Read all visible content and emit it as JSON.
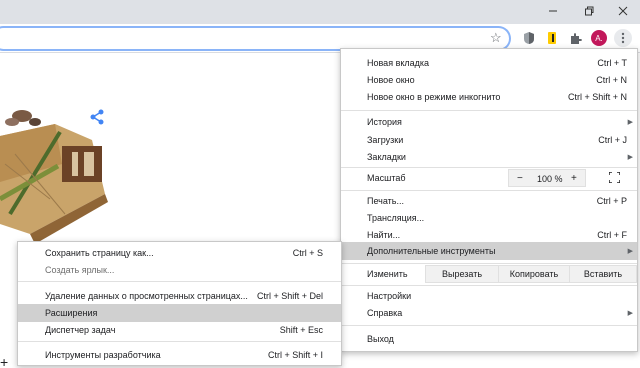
{
  "toolbar": {
    "avatar_letter": "A."
  },
  "menu": {
    "group1": [
      {
        "label": "Новая вкладка",
        "shortcut": "Ctrl + T"
      },
      {
        "label": "Новое окно",
        "shortcut": "Ctrl + N"
      },
      {
        "label": "Новое окно в режиме инкогнито",
        "shortcut": "Ctrl + Shift + N"
      }
    ],
    "group2": [
      {
        "label": "История",
        "shortcut": ""
      },
      {
        "label": "Загрузки",
        "shortcut": "Ctrl + J"
      },
      {
        "label": "Закладки",
        "shortcut": ""
      }
    ],
    "zoom": {
      "label": "Масштаб",
      "minus": "−",
      "value": "100 %",
      "plus": "+"
    },
    "group3": [
      {
        "label": "Печать...",
        "shortcut": "Ctrl + P"
      },
      {
        "label": "Трансляция...",
        "shortcut": ""
      },
      {
        "label": "Найти...",
        "shortcut": "Ctrl + F"
      },
      {
        "label": "Дополнительные инструменты",
        "shortcut": ""
      }
    ],
    "edit": {
      "label": "Изменить",
      "cut": "Вырезать",
      "copy": "Копировать",
      "paste": "Вставить"
    },
    "group4": [
      {
        "label": "Настройки",
        "shortcut": ""
      },
      {
        "label": "Справка",
        "shortcut": ""
      }
    ],
    "exit": {
      "label": "Выход"
    }
  },
  "submenu": {
    "items": [
      {
        "label": "Сохранить страницу как...",
        "shortcut": "Ctrl + S"
      },
      {
        "label": "Создать ярлык...",
        "shortcut": ""
      },
      {
        "label": "Удаление данных о просмотренных страницах...",
        "shortcut": "Ctrl + Shift + Del"
      },
      {
        "label": "Расширения",
        "shortcut": ""
      },
      {
        "label": "Диспетчер задач",
        "shortcut": "Shift + Esc"
      },
      {
        "label": "Инструменты разработчика",
        "shortcut": "Ctrl + Shift + I"
      }
    ]
  },
  "page": {
    "plus": "+"
  },
  "colors": {
    "titlebar": "#dee1e6",
    "highlight": "#d0d0d0",
    "avatar": "#c2185b",
    "share_icon": "#4285f4"
  }
}
